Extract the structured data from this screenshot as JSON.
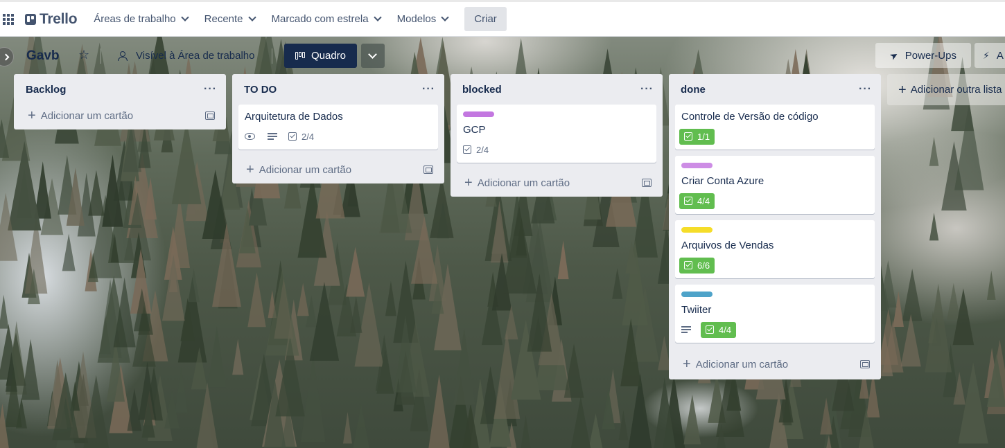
{
  "header": {
    "logo_text": "Trello",
    "nav": [
      {
        "label": "Áreas de trabalho"
      },
      {
        "label": "Recente"
      },
      {
        "label": "Marcado com estrela"
      },
      {
        "label": "Modelos"
      }
    ],
    "create_label": "Criar"
  },
  "board": {
    "title": "Gavb",
    "visibility": "Visível à Área de trabalho",
    "view_label": "Quadro",
    "powerups_label": "Power-Ups",
    "automation_label": "A"
  },
  "lists": [
    {
      "title": "Backlog",
      "add_label": "Adicionar um cartão",
      "cards": []
    },
    {
      "title": "TO DO",
      "add_label": "Adicionar um cartão",
      "cards": [
        {
          "title": "Arquitetura de Dados",
          "checklist": "2/4",
          "watching": true,
          "description": true
        }
      ]
    },
    {
      "title": "blocked",
      "add_label": "Adicionar um cartão",
      "cards": [
        {
          "title": "GCP",
          "label_color": "#c377e0",
          "checklist": "2/4"
        }
      ]
    },
    {
      "title": "done",
      "add_label": "Adicionar um cartão",
      "cards": [
        {
          "title": "Controle de Versão de código",
          "checklist": "1/1",
          "complete": true
        },
        {
          "title": "Criar Conta Azure",
          "label_color": "#cd8de5",
          "checklist": "4/4",
          "complete": true
        },
        {
          "title": "Arquivos de Vendas",
          "label_color": "#f5dd29",
          "checklist": "6/6",
          "complete": true
        },
        {
          "title": "Twiiter",
          "label_color": "#29cce5",
          "checklist": "4/4",
          "complete": true,
          "description": true
        }
      ]
    }
  ],
  "add_list_label": "Adicionar outra lista",
  "colors": {
    "complete_badge": "#61bd4f",
    "header_bg": "#ffffff",
    "list_bg": "#ebecf0",
    "view_button": "#172b4d"
  },
  "icons": [
    "apps-grid-icon",
    "trello-logo-icon",
    "chevron-down-icon",
    "star-icon",
    "people-icon",
    "board-icon",
    "rocket-icon",
    "bolt-icon",
    "dots-icon",
    "eye-icon",
    "description-icon",
    "checklist-icon",
    "plus-icon",
    "template-icon"
  ]
}
